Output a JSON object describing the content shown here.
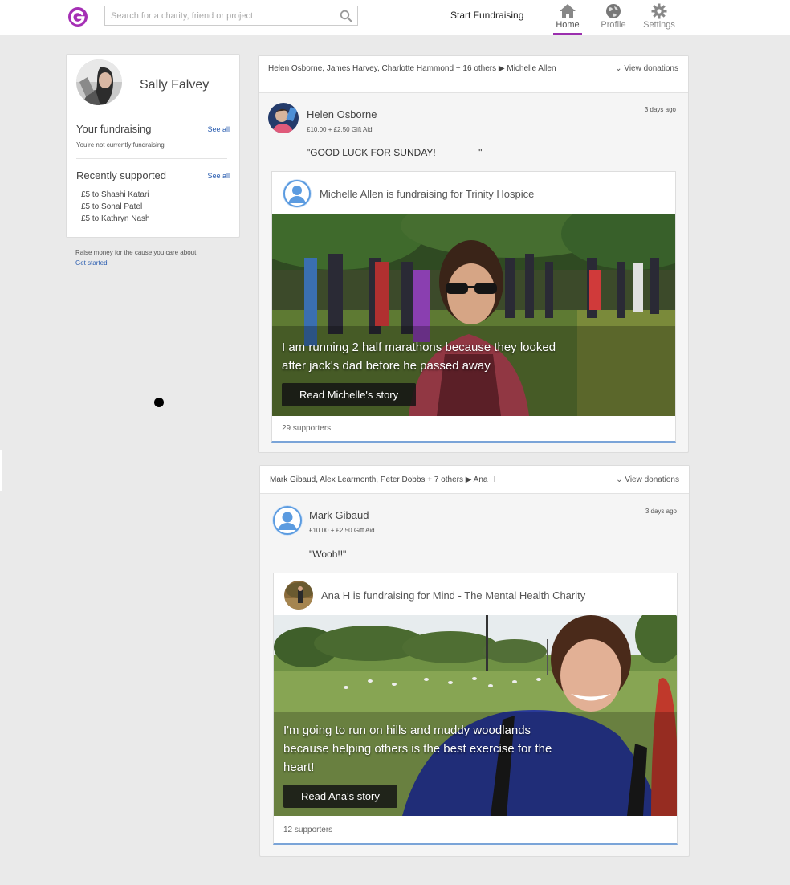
{
  "header": {
    "search_placeholder": "Search for a charity, friend or project",
    "start_fundraising": "Start Fundraising",
    "nav": [
      {
        "label": "Home",
        "active": true
      },
      {
        "label": "Profile",
        "active": false
      },
      {
        "label": "Settings",
        "active": false
      }
    ],
    "accent_color": "#9b2fae",
    "icons": [
      "g-logo-icon",
      "search-icon",
      "home-icon",
      "profile-globe-icon",
      "gear-icon"
    ]
  },
  "profile": {
    "name": "Sally Falvey",
    "your_fundraising_title": "Your fundraising",
    "your_fundraising_see_all": "See all",
    "not_fundraising": "You're not currently fundraising",
    "recently_supported_title": "Recently supported",
    "recently_supported_see_all": "See all",
    "recently_supported": [
      "£5 to Shashi Katari",
      "£5 to Sonal Patel",
      "£5 to Kathryn Nash"
    ],
    "raise_money_text": "Raise money for the cause you care about.",
    "get_started": "Get started"
  },
  "feed": [
    {
      "header_names": "Helen Osborne, James Harvey, Charlotte Hammond + 16 others ▶ Michelle Allen",
      "view_donations": "View donations",
      "donor_name": "Helen Osborne",
      "donor_amount": "£10.00 + £2.50 Gift Aid",
      "time": "3 days ago",
      "message": "\"GOOD LUCK FOR SUNDAY!                \"",
      "story_title": "Michelle Allen is fundraising for Trinity Hospice",
      "caption_line1": "I am running 2 half marathons because they looked",
      "caption_line2": "after jack's dad before he passed away",
      "button": "Read Michelle's story",
      "supporters": "29 supporters"
    },
    {
      "header_names": "Mark Gibaud, Alex Learmonth, Peter Dobbs + 7 others ▶ Ana H",
      "view_donations": "View donations",
      "donor_name": "Mark Gibaud",
      "donor_amount": "£10.00 + £2.50 Gift Aid",
      "time": "3 days ago",
      "message": "\"Wooh!!\"",
      "story_title": "Ana H is fundraising for Mind - The Mental Health Charity",
      "caption_line1": "I'm going to run on hills and muddy woodlands",
      "caption_line2": "because helping others is the best exercise for the",
      "caption_line3": "heart!",
      "button": "Read Ana's story",
      "supporters": "12 supporters"
    }
  ]
}
